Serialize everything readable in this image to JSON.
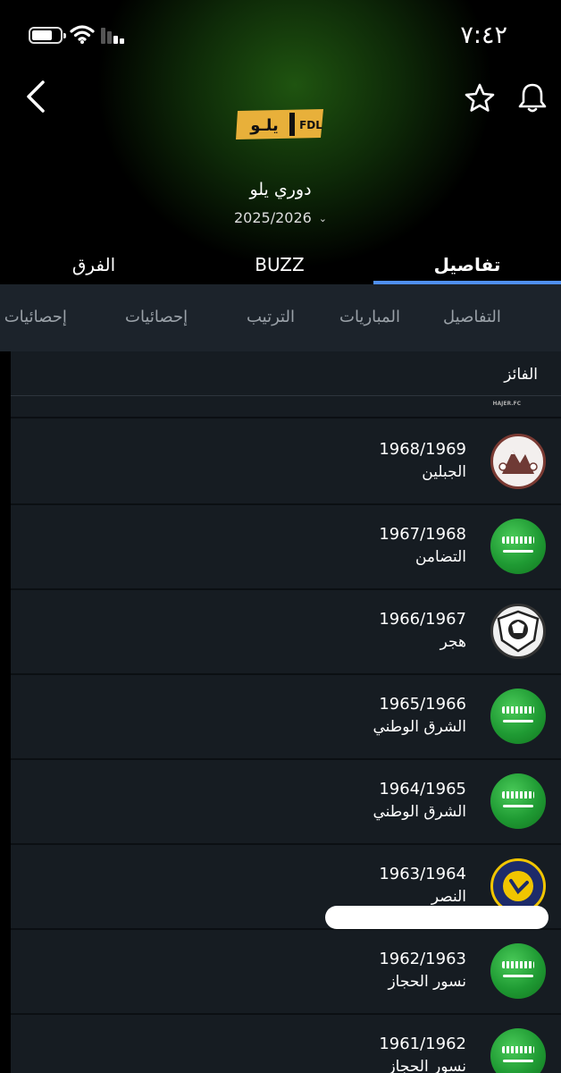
{
  "status_bar": {
    "time": "٧:٤٢"
  },
  "header": {
    "league_logo_text": "يلـو",
    "league_logo_tag": "FDL",
    "league_name": "دوري يلو",
    "season": "2025/2026"
  },
  "main_tabs": [
    {
      "label": "تفاصيل",
      "active": true
    },
    {
      "label": "BUZZ",
      "active": false
    },
    {
      "label": "الفرق",
      "active": false
    }
  ],
  "sub_tabs": [
    {
      "label": "التفاصيل"
    },
    {
      "label": "المباريات"
    },
    {
      "label": "الترتيب"
    },
    {
      "label": "إحصائيات"
    },
    {
      "label": "إحصائيات ا"
    }
  ],
  "winners": {
    "header": "الفائز",
    "spacer_tag": "HAJER.FC",
    "rows": [
      {
        "season": "1968/1969",
        "club": "الجبلين",
        "crest": "jabalain-crest"
      },
      {
        "season": "1967/1968",
        "club": "التضامن",
        "crest": "saudi-flag-crest"
      },
      {
        "season": "1966/1967",
        "club": "هجر",
        "crest": "hajer-crest"
      },
      {
        "season": "1965/1966",
        "club": "الشرق الوطني",
        "crest": "saudi-flag-crest"
      },
      {
        "season": "1964/1965",
        "club": "الشرق الوطني",
        "crest": "saudi-flag-crest"
      },
      {
        "season": "1963/1964",
        "club": "النصر",
        "crest": "nassr-crest"
      },
      {
        "season": "1962/1963",
        "club": "نسور الحجاز",
        "crest": "saudi-flag-crest"
      },
      {
        "season": "1961/1962",
        "club": "نسور الحجاز",
        "crest": "saudi-flag-crest"
      }
    ]
  },
  "colors": {
    "accent": "#4f8ff2",
    "list_bg": "#161c22",
    "subtab_bg": "#1c232b"
  }
}
